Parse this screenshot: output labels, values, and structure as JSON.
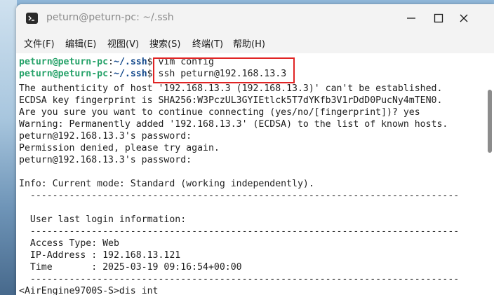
{
  "window": {
    "title": "peturn@peturn-pc: ~/.ssh"
  },
  "menu": {
    "items": [
      "文件(F)",
      "编辑(E)",
      "视图(V)",
      "搜索(S)",
      "终端(T)",
      "帮助(H)"
    ]
  },
  "terminal": {
    "prompt_user": "peturn@peturn-pc",
    "prompt_path": "~/.ssh",
    "prompt_symbol": "$",
    "commands": [
      "vim config",
      "ssh peturn@192.168.13.3"
    ],
    "output_lines": [
      "The authenticity of host '192.168.13.3 (192.168.13.3)' can't be established.",
      "ECDSA key fingerprint is SHA256:W3PczUL3GYIEtlck5T7dYKfb3V1rDdD0PucNy4mTEN0.",
      "Are you sure you want to continue connecting (yes/no/[fingerprint])? yes",
      "Warning: Permanently added '192.168.13.3' (ECDSA) to the list of known hosts.",
      "peturn@192.168.13.3's password:",
      "Permission denied, please try again.",
      "peturn@192.168.13.3's password:",
      "",
      "Info: Current mode: Standard (working independently).",
      "  -----------------------------------------------------------------------------",
      "",
      "  User last login information:",
      "  -----------------------------------------------------------------------------",
      "  Access Type: Web",
      "  IP-Address : 192.168.13.121",
      "  Time       : 2025-03-19 09:16:54+00:00",
      "  -----------------------------------------------------------------------------",
      "<AirEngine9700S-S>dis int"
    ]
  },
  "colors": {
    "prompt_user": "#26a269",
    "prompt_path": "#12488b",
    "highlight_border": "#e02424"
  },
  "icons": {
    "app": "terminal-icon",
    "minimize": "minimize-icon",
    "maximize": "maximize-icon",
    "close": "close-icon"
  }
}
